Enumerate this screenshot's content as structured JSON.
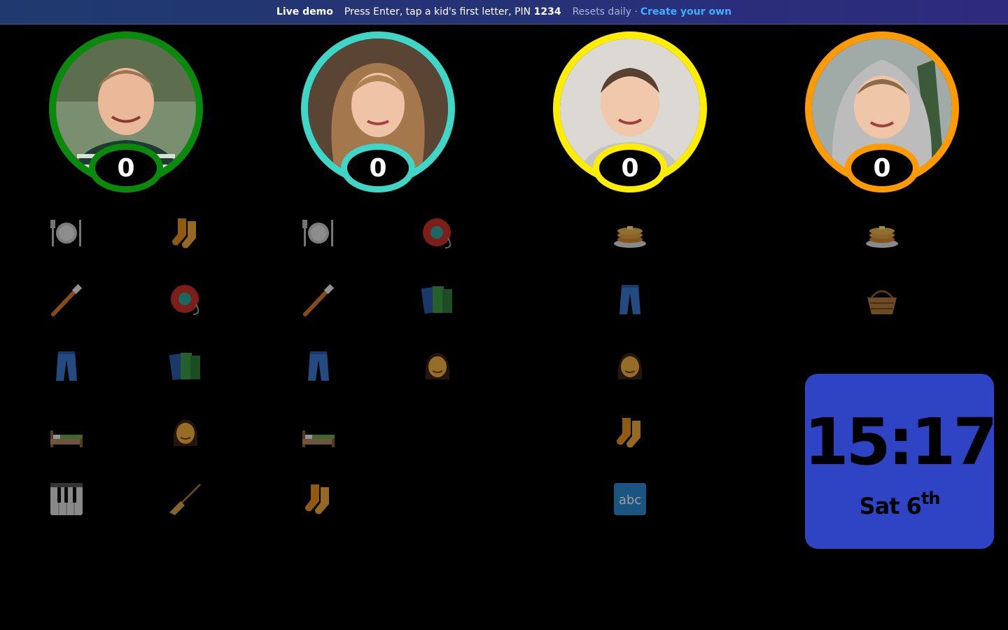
{
  "banner": {
    "live_label": "Live demo",
    "instructions_pre": "Press Enter, tap a kid's first letter, PIN",
    "pin": "1234",
    "resets": "Resets daily ·",
    "create_link": "Create your own"
  },
  "kids": [
    {
      "ring_color": "#0a8a0a",
      "score": "0",
      "photo_bg": "#7a8f70",
      "shirt": "#2a4a3a"
    },
    {
      "ring_color": "#3fd6c8",
      "score": "0",
      "photo_bg": "#8a7058",
      "shirt": "#2c3f66"
    },
    {
      "ring_color": "#ffee00",
      "score": "0",
      "photo_bg": "#d8d4d0",
      "shirt": "#c8c8c8"
    },
    {
      "ring_color": "#ff9b00",
      "score": "0",
      "photo_bg": "#9aa4a0",
      "shirt": "#b8b8b8"
    }
  ],
  "chores": {
    "kid1_left": [
      "fork-plate-icon",
      "toothbrush-icon",
      "jeans-icon",
      "bed-icon",
      "piano-icon"
    ],
    "kid1_right": [
      "socks-icon",
      "yoyo-icon",
      "books-icon",
      "woman-icon",
      "broom-icon"
    ],
    "kid2_left": [
      "fork-plate-icon",
      "toothbrush-icon",
      "jeans-icon",
      "bed-icon",
      "socks-icon"
    ],
    "kid2_right": [
      "yoyo-icon",
      "books-icon",
      "woman-icon"
    ],
    "kid3": [
      "pancakes-icon",
      "jeans-icon",
      "woman-icon",
      "socks-icon",
      "abc-icon"
    ],
    "kid4": [
      "pancakes-icon",
      "basket-icon"
    ]
  },
  "clock": {
    "time": "15:17",
    "day": "Sat 6",
    "suffix": "th"
  }
}
